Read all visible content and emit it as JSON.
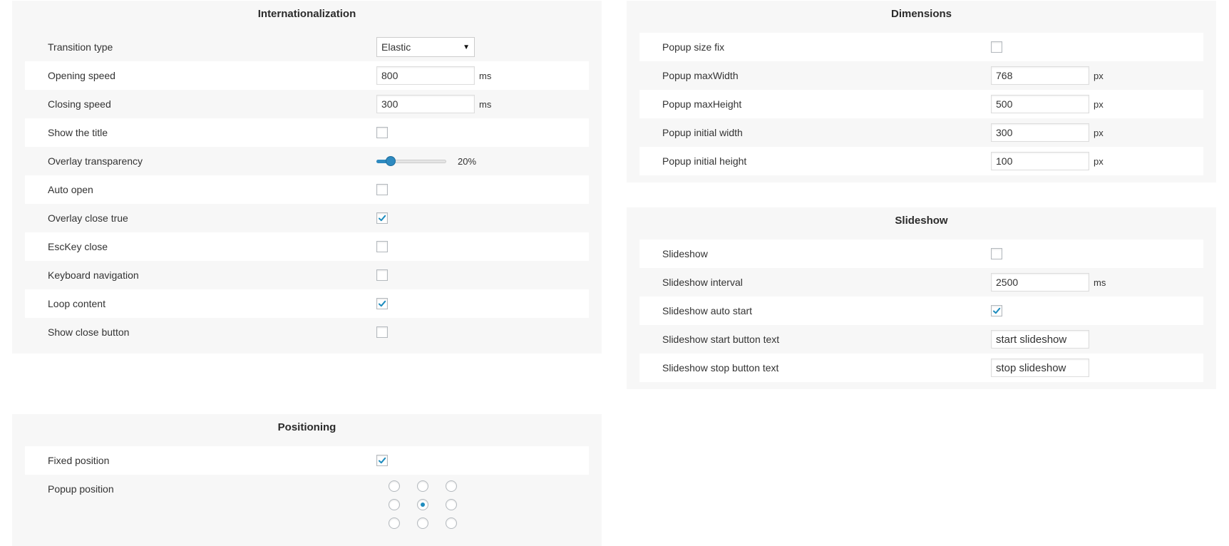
{
  "internationalization": {
    "title": "Internationalization",
    "transition_type": {
      "label": "Transition type",
      "value": "Elastic"
    },
    "opening_speed": {
      "label": "Opening speed",
      "value": "800",
      "unit": "ms"
    },
    "closing_speed": {
      "label": "Closing speed",
      "value": "300",
      "unit": "ms"
    },
    "show_title": {
      "label": "Show the title",
      "checked": false
    },
    "overlay_transparency": {
      "label": "Overlay transparency",
      "value_text": "20%",
      "value_percent": 20
    },
    "auto_open": {
      "label": "Auto open",
      "checked": false
    },
    "overlay_close": {
      "label": "Overlay close true",
      "checked": true
    },
    "esckey_close": {
      "label": "EscKey close",
      "checked": false
    },
    "keyboard_navigation": {
      "label": "Keyboard navigation",
      "checked": false
    },
    "loop_content": {
      "label": "Loop content",
      "checked": true
    },
    "show_close_button": {
      "label": "Show close button",
      "checked": false
    }
  },
  "dimensions": {
    "title": "Dimensions",
    "popup_size_fix": {
      "label": "Popup size fix",
      "checked": false
    },
    "max_width": {
      "label": "Popup maxWidth",
      "value": "768",
      "unit": "px"
    },
    "max_height": {
      "label": "Popup maxHeight",
      "value": "500",
      "unit": "px"
    },
    "initial_width": {
      "label": "Popup initial width",
      "value": "300",
      "unit": "px"
    },
    "initial_height": {
      "label": "Popup initial height",
      "value": "100",
      "unit": "px"
    }
  },
  "slideshow": {
    "title": "Slideshow",
    "enabled": {
      "label": "Slideshow",
      "checked": false
    },
    "interval": {
      "label": "Slideshow interval",
      "value": "2500",
      "unit": "ms"
    },
    "auto_start": {
      "label": "Slideshow auto start",
      "checked": true
    },
    "start_text": {
      "label": "Slideshow start button text",
      "value": "start slideshow"
    },
    "stop_text": {
      "label": "Slideshow stop button text",
      "value": "stop slideshow"
    }
  },
  "positioning": {
    "title": "Positioning",
    "fixed_position": {
      "label": "Fixed position",
      "checked": true
    },
    "popup_position": {
      "label": "Popup position",
      "options": 9,
      "selected_index": 4
    }
  },
  "colors": {
    "accent": "#2e8ac0",
    "check": "#1e8cbe",
    "panel_bg": "#f7f7f7"
  }
}
